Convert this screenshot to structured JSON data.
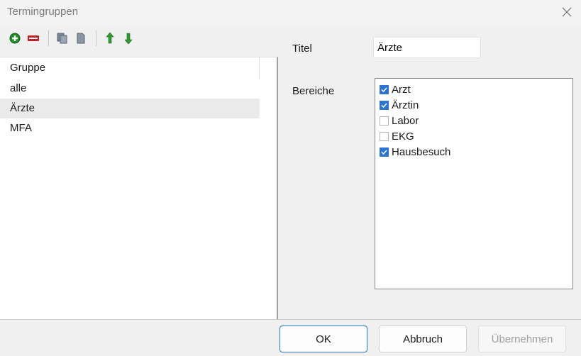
{
  "window": {
    "title": "Termingruppen"
  },
  "toolbar": {
    "icons": [
      "add-icon",
      "remove-icon",
      "copy-icon",
      "paste-icon",
      "move-up-icon",
      "move-down-icon"
    ]
  },
  "list": {
    "header": "Gruppe",
    "items": [
      "alle",
      "Ärzte",
      "MFA"
    ],
    "selected": "Ärzte"
  },
  "details": {
    "title_label": "Titel",
    "title_value": "Ärzte",
    "areas_label": "Bereiche",
    "areas": [
      {
        "label": "Arzt",
        "checked": true
      },
      {
        "label": "Ärztin",
        "checked": true
      },
      {
        "label": "Labor",
        "checked": false
      },
      {
        "label": "EKG",
        "checked": false
      },
      {
        "label": "Hausbesuch",
        "checked": true
      }
    ]
  },
  "buttons": {
    "ok": "OK",
    "cancel": "Abbruch",
    "apply": "Übernehmen"
  },
  "colors": {
    "accent": "#2f73d2",
    "add_green": "#1f8f2a",
    "remove_red": "#c0202a",
    "arrow_green": "#2e9a30"
  }
}
